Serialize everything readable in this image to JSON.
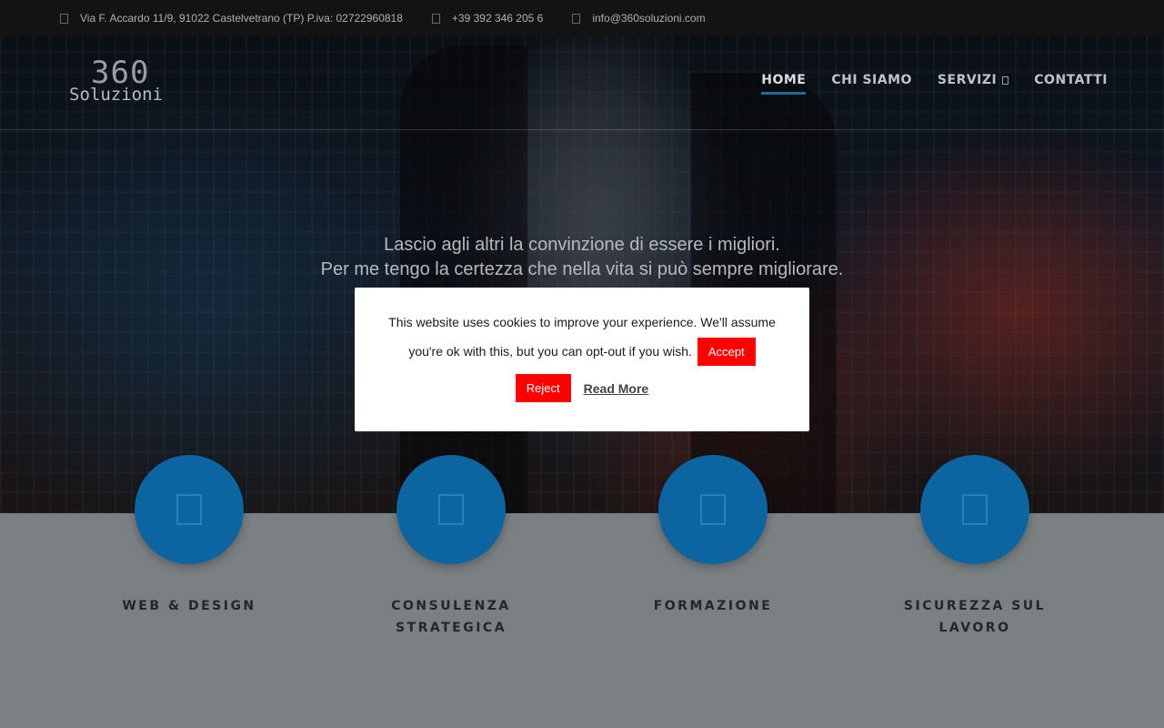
{
  "topbar": {
    "address": "Via F. Accardo 11/9, 91022 Castelvetrano (TP) P.iva: 02722960818",
    "phone": "+39 392 346 205 6",
    "email": "info@360soluzioni.com",
    "icons": [
      "map-marker-icon",
      "phone-icon",
      "envelope-icon"
    ]
  },
  "logo": {
    "number": "360",
    "word": "Soluzioni"
  },
  "nav": {
    "items": [
      {
        "label": "HOME",
        "active": true
      },
      {
        "label": "CHI SIAMO"
      },
      {
        "label": "SERVIZI",
        "has_dropdown": true
      },
      {
        "label": "CONTATTI"
      }
    ]
  },
  "hero": {
    "quote_line1": "Lascio agli altri la convinzione di essere i migliori.",
    "quote_line2": "Per me tengo la certezza che nella vita si può sempre migliorare."
  },
  "cookie": {
    "text_line1": "This website uses cookies to improve your experience. We'll assume",
    "text_line2": "you're ok with this, but you can opt-out if you wish.",
    "accept": "Accept",
    "reject": "Reject",
    "read_more": "Read More",
    "button_color": "#ff0000"
  },
  "services": [
    {
      "title": "WEB & DESIGN"
    },
    {
      "title_line1": "CONSULENZA",
      "title_line2": "STRATEGICA"
    },
    {
      "title": "FORMAZIONE"
    },
    {
      "title_line1": "SICUREZZA SUL",
      "title_line2": "LAVORO"
    }
  ],
  "colors": {
    "accent": "#0c64a1",
    "nav_underline": "#1e6b9a",
    "topbar_bg": "#131313",
    "section_bg": "#7b8083"
  }
}
